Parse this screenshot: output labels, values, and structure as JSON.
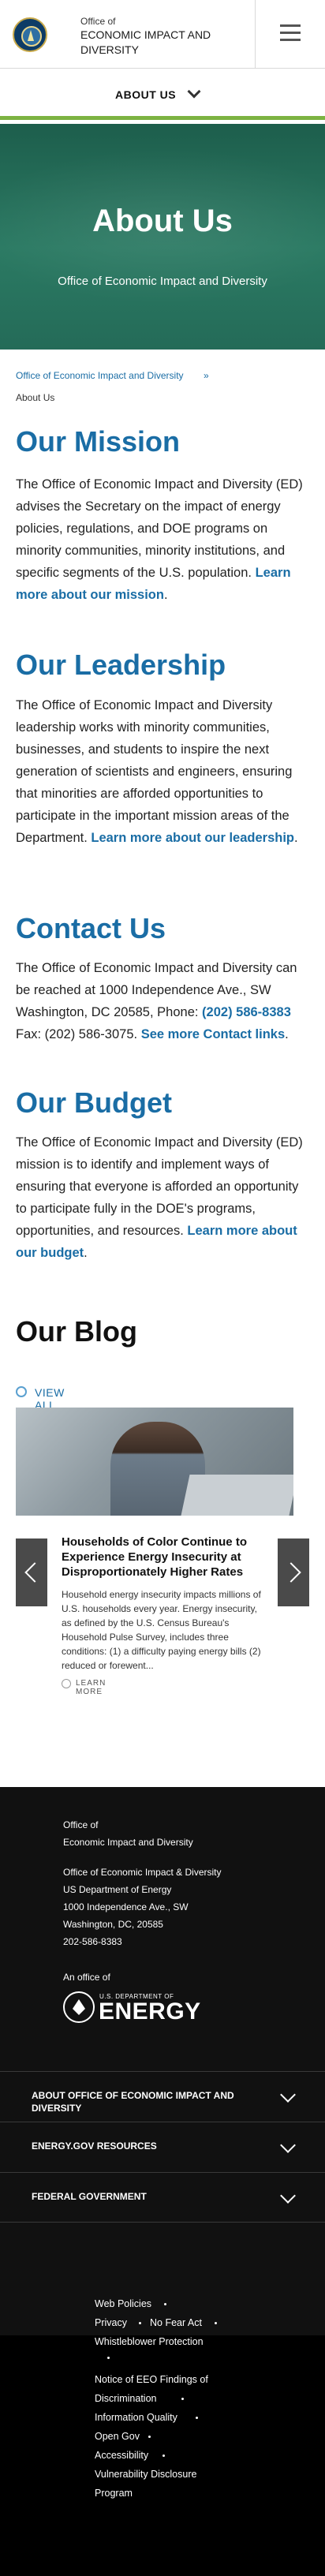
{
  "header": {
    "office_small": "Office of",
    "office_title_line1": "ECONOMIC IMPACT AND",
    "office_title_line2": "DIVERSITY",
    "seal_icon": "doe-seal-icon",
    "menu_icon": "hamburger-menu-icon"
  },
  "section_nav": {
    "label": "ABOUT US",
    "chevron_icon": "chevron-down-icon"
  },
  "hero": {
    "title": "About Us",
    "subtitle": "Office of Economic Impact and Diversity",
    "bg_color": "#2b7a63"
  },
  "breadcrumb": {
    "link": "Office of Economic Impact and Diversity",
    "separator": "»",
    "current": "About Us"
  },
  "sections": {
    "mission": {
      "heading": "Our Mission",
      "text": "The Office of Economic Impact and Diversity (ED) advises the Secretary on the impact of energy policies, regulations, and DOE programs on minority communities, minority institutions, and specific segments of the U.S. population. ",
      "link": "Learn more about our mission",
      "end": "."
    },
    "leadership": {
      "heading": "Our Leadership",
      "text": "The Office of Economic Impact and Diversity leadership works with minority communities, businesses, and students to inspire the next generation of scientists and engineers, ensuring that minorities are afforded opportunities to participate in the important mission areas of the Department. ",
      "link": "Learn more about our leadership",
      "end": "."
    },
    "contact": {
      "heading": "Contact Us",
      "text": "The Office of Economic Impact and Diversity can be reached at 1000 Independence Ave., SW Washington, DC 20585, Phone: ",
      "phone": "(202) 586-8383",
      "fax": " Fax: (202) 586-3075. ",
      "link": "See more Contact links",
      "end": "."
    },
    "budget": {
      "heading": "Our Budget",
      "text": "The Office of Economic Impact and Diversity (ED) mission is to identify and implement ways of ensuring that everyone is afforded an opportunity to participate fully in the DOE's programs, opportunities, and resources. ",
      "link": "Learn more about our budget",
      "end": "."
    }
  },
  "blog": {
    "title": "Our Blog",
    "view_all": "VIEW ALL",
    "card_title": "Households of Color Continue to Experience Energy Insecurity at Disproportionately Higher Rates",
    "card_body": "Household energy insecurity impacts millions of U.S. households every year. Energy insecurity, as defined by the U.S. Census Bureau's Household Pulse Survey, includes three conditions: (1) a difficulty paying energy bills (2) reduced or forewent...",
    "learn_more": "LEARN MORE",
    "prev_icon": "arrow-left-icon",
    "next_icon": "arrow-right-icon"
  },
  "footer": {
    "office_of": "Office of",
    "office_name": "Economic Impact and Diversity",
    "address_lines": [
      "Office of Economic Impact & Diversity",
      "US Department of Energy",
      "1000 Independence Ave., SW",
      "Washington, DC, 20585",
      "202-586-8383"
    ],
    "an_office_of": "An office of",
    "doe_small": "U.S. DEPARTMENT OF",
    "doe_big": "ENERGY",
    "accordion": [
      "ABOUT OFFICE OF ECONOMIC IMPACT AND DIVERSITY",
      "ENERGY.GOV RESOURCES",
      "FEDERAL GOVERNMENT"
    ],
    "links": {
      "web_policies": "Web Policies",
      "privacy": "Privacy",
      "no_fear_act": "No Fear Act",
      "whistleblower": "Whistleblower Protection",
      "eeo_line1": "Notice of EEO Findings of",
      "eeo_line2": "Discrimination",
      "information_quality": "Information Quality",
      "open_gov": "Open Gov",
      "accessibility": "Accessibility",
      "vdp_line1": "Vulnerability Disclosure",
      "vdp_line2": "Program"
    }
  }
}
